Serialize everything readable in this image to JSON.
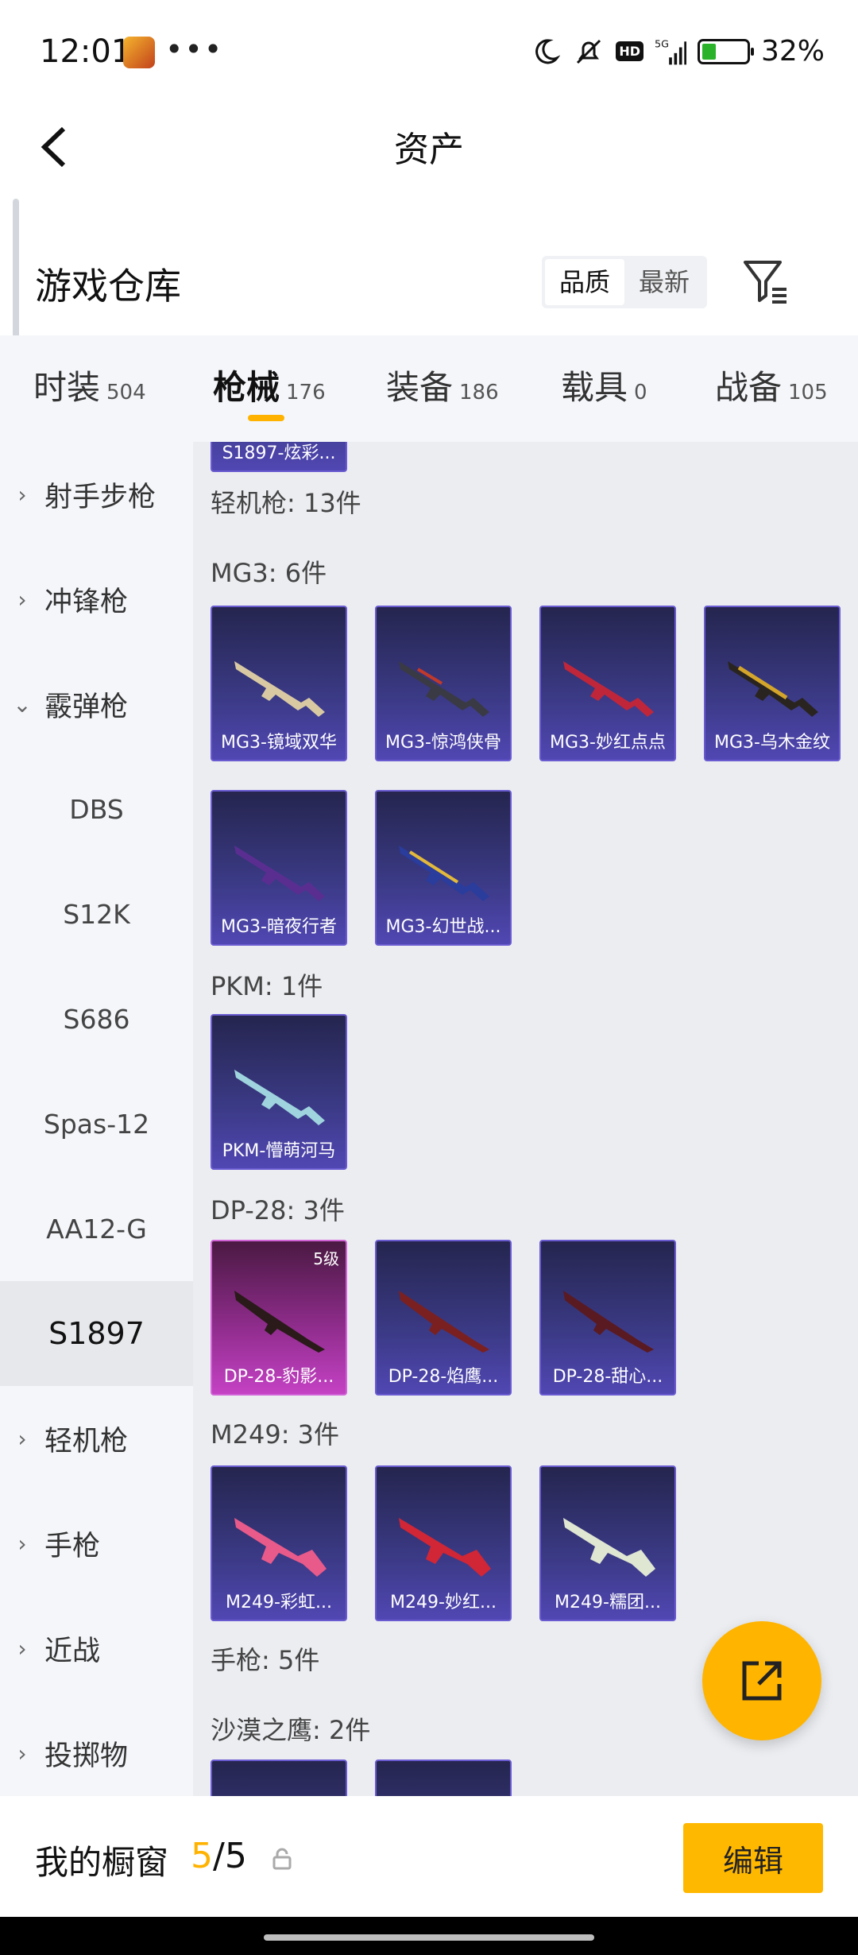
{
  "status_bar": {
    "time": "12:01",
    "dots": "•••",
    "network": "5G",
    "hd": "HD",
    "battery": "32%",
    "battery_level": 0.32
  },
  "header": {
    "title": "资产"
  },
  "warehouse": {
    "title": "游戏仓库",
    "sort_options": [
      "品质",
      "最新"
    ],
    "sort_active": "品质"
  },
  "tabs": [
    {
      "label": "时装",
      "count": "504"
    },
    {
      "label": "枪械",
      "count": "176",
      "active": true
    },
    {
      "label": "装备",
      "count": "186"
    },
    {
      "label": "载具",
      "count": "0"
    },
    {
      "label": "战备",
      "count": "105"
    }
  ],
  "sidebar": [
    {
      "label": "射手步枪",
      "type": "category"
    },
    {
      "label": "冲锋枪",
      "type": "category"
    },
    {
      "label": "霰弹枪",
      "type": "category",
      "expanded": true
    },
    {
      "label": "DBS",
      "type": "sub"
    },
    {
      "label": "S12K",
      "type": "sub"
    },
    {
      "label": "S686",
      "type": "sub"
    },
    {
      "label": "Spas-12",
      "type": "sub"
    },
    {
      "label": "AA12-G",
      "type": "sub"
    },
    {
      "label": "S1897",
      "type": "sub",
      "selected": true
    },
    {
      "label": "轻机枪",
      "type": "category"
    },
    {
      "label": "手枪",
      "type": "category"
    },
    {
      "label": "近战",
      "type": "category"
    },
    {
      "label": "投掷物",
      "type": "category"
    }
  ],
  "content": {
    "partial_top_card": "S1897-炫彩...",
    "lmg_header": "轻机枪: 13件",
    "groups": [
      {
        "title": "MG3: 6件",
        "items": [
          "MG3-镜域双华",
          "MG3-惊鸿侠骨",
          "MG3-妙红点点",
          "MG3-乌木金纹",
          "MG3-暗夜行者",
          "MG3-幻世战..."
        ]
      },
      {
        "title": "PKM: 1件",
        "items": [
          "PKM-懵萌河马"
        ]
      },
      {
        "title": "DP-28: 3件",
        "items": [
          "DP-28-豹影...",
          "DP-28-焰鹰...",
          "DP-28-甜心..."
        ],
        "first_level": "5级"
      },
      {
        "title": "M249: 3件",
        "items": [
          "M249-彩虹...",
          "M249-妙红...",
          "M249-糯团..."
        ]
      }
    ],
    "pistol_header": "手枪: 5件",
    "deagle_header": "沙漠之鹰: 2件"
  },
  "bottom_bar": {
    "title": "我的橱窗",
    "current": "5",
    "total": "/5",
    "edit_label": "编辑"
  },
  "colors": {
    "accent": "#ffb300",
    "card_purple": "#3b3a86",
    "card_rare": "#8e2c8b"
  }
}
